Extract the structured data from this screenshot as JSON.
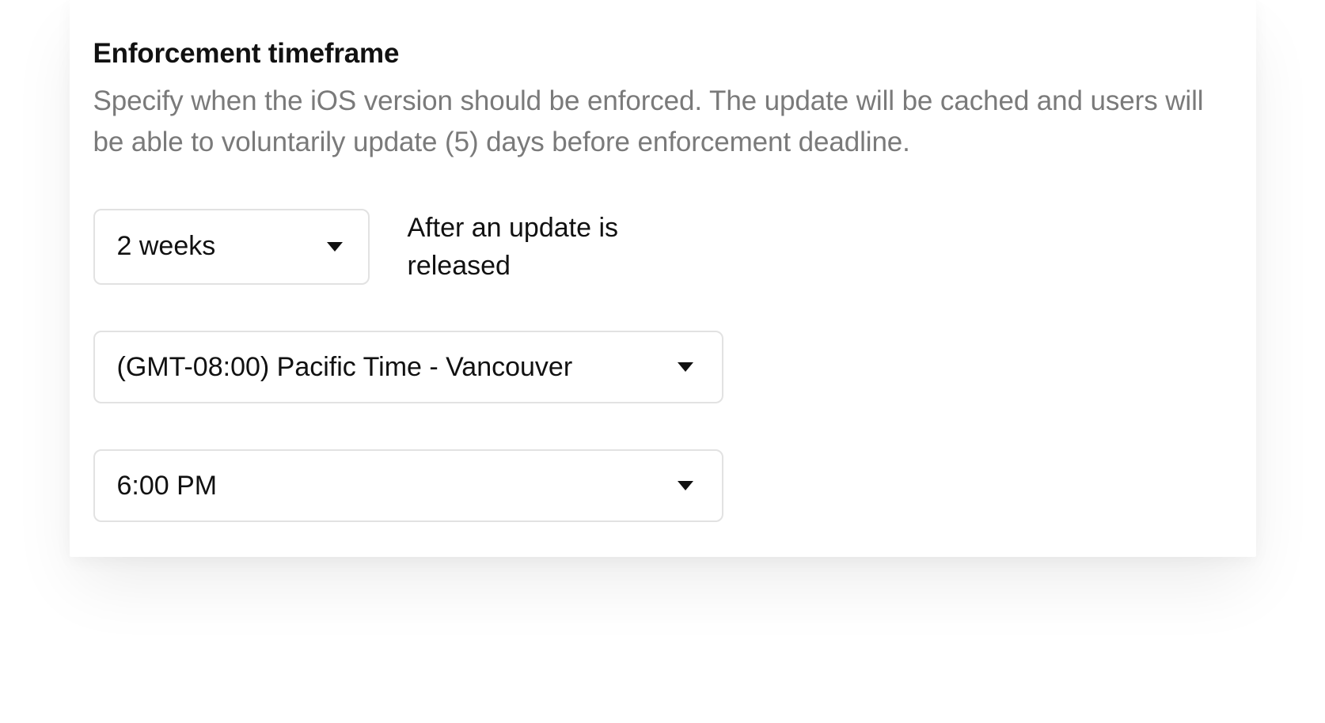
{
  "section": {
    "title": "Enforcement timeframe",
    "description": "Specify when the iOS version should be enforced. The update will be cached and users will be able to voluntarily update (5) days before enforcement deadline."
  },
  "duration_select": {
    "value": "2 weeks"
  },
  "after_label": "After an update is released",
  "timezone_select": {
    "value": "(GMT-08:00) Pacific Time - Vancouver"
  },
  "time_select": {
    "value": "6:00 PM"
  }
}
